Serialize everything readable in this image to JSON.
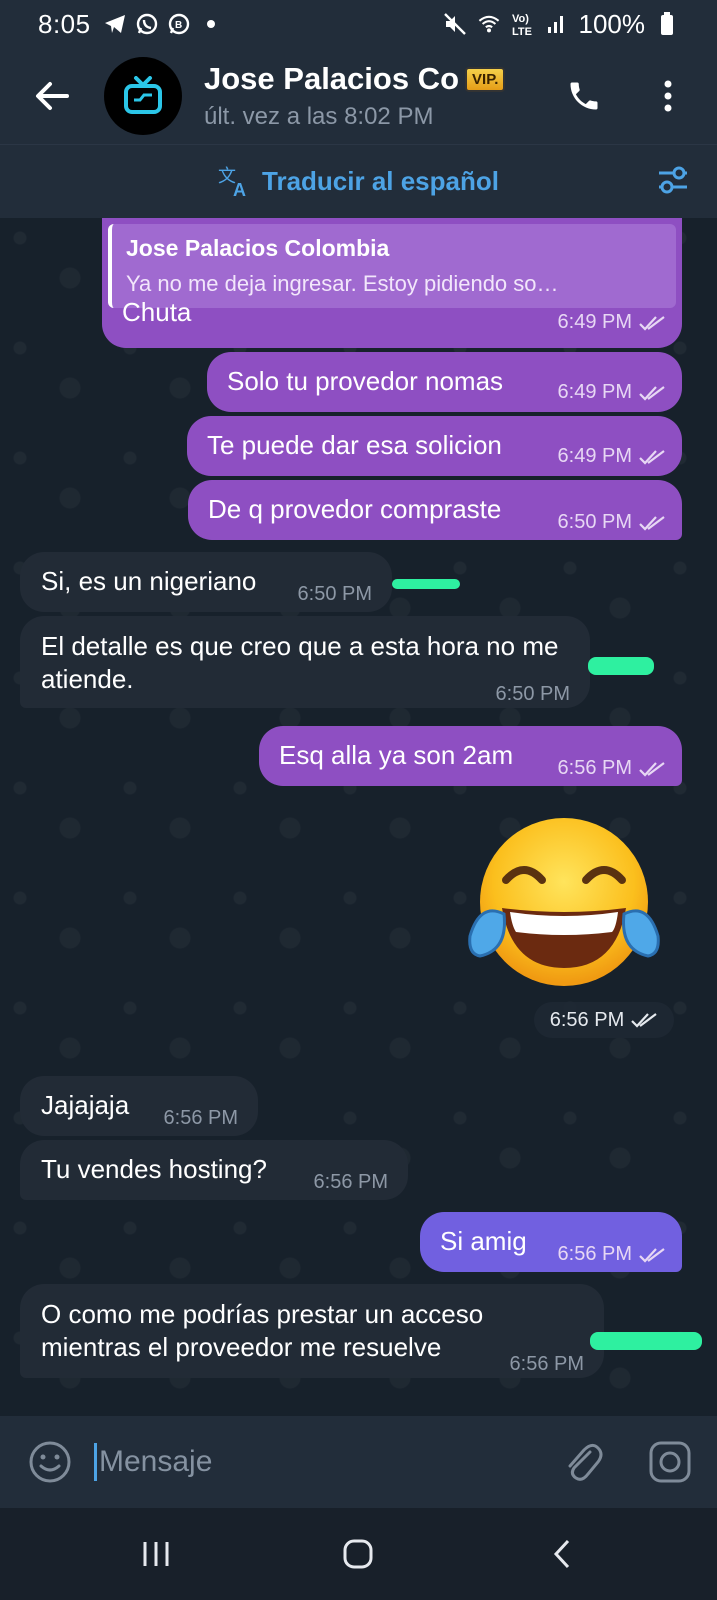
{
  "status_bar": {
    "time": "8:05",
    "battery": "100%",
    "left_icons": [
      "telegram-icon",
      "whatsapp-icon",
      "whatsapp-business-icon",
      "dot-icon"
    ],
    "right_icons": [
      "mute-icon",
      "wifi-icon",
      "volte-icon",
      "signal-icon",
      "battery-icon"
    ],
    "volte_label": "Vo)\nLTE"
  },
  "header": {
    "title": "Jose Palacios Co",
    "badge": "VIP.",
    "subtitle": "últ. vez a las 8:02 PM",
    "avatar_icon": "tv-icon"
  },
  "translate_bar": {
    "label": "Traducir al español"
  },
  "messages": [
    {
      "dir": "out",
      "reply_name": "Jose Palacios Colombia",
      "reply_text": "Ya no me deja ingresar.  Estoy pidiendo so…",
      "text": "Chuta",
      "time": "6:49 PM"
    },
    {
      "dir": "out",
      "text": "Solo tu provedor nomas",
      "time": "6:49 PM"
    },
    {
      "dir": "out",
      "text": "Te puede dar esa solicion",
      "time": "6:49 PM"
    },
    {
      "dir": "out",
      "text": "De q provedor compraste",
      "time": "6:50 PM"
    },
    {
      "dir": "in",
      "text": "Si, es un nigeriano",
      "time": "6:50 PM"
    },
    {
      "dir": "in",
      "text": "El detalle es que creo que a esta hora no me atiende.",
      "time": "6:50 PM"
    },
    {
      "dir": "out",
      "text": "Esq alla ya son 2am",
      "time": "6:56 PM"
    },
    {
      "dir": "out",
      "text": "😂",
      "time": "6:56 PM"
    },
    {
      "dir": "in",
      "text": "Jajajaja",
      "time": "6:56 PM"
    },
    {
      "dir": "in",
      "text": "Tu vendes hosting?",
      "time": "6:56 PM"
    },
    {
      "dir": "out",
      "text": "Si amig",
      "time": "6:56 PM"
    },
    {
      "dir": "in",
      "text": "O como me podrías prestar un acceso mientras el proveedor me resuelve",
      "time": "6:56 PM"
    }
  ],
  "composer": {
    "placeholder": "Mensaje"
  },
  "colors": {
    "outgoing": "#8e4fc2",
    "outgoing_last": "#7160e0",
    "incoming": "#222b36",
    "accent": "#4da3e5",
    "redaction": "#2ef0a0"
  }
}
